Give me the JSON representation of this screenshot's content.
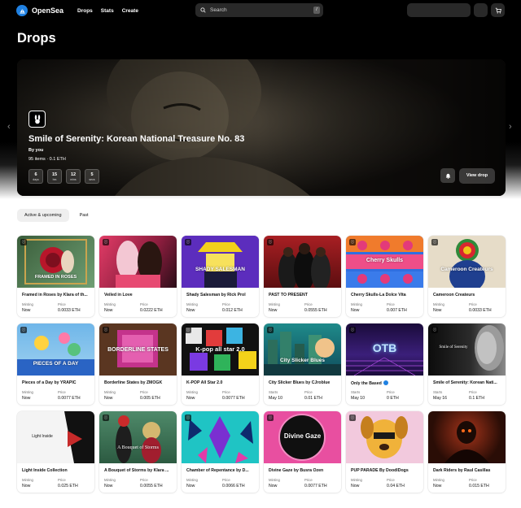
{
  "nav": {
    "brand": "OpenSea",
    "links": [
      "Drops",
      "Stats",
      "Create"
    ],
    "search_placeholder": "Search",
    "search_shortcut": "/"
  },
  "page": {
    "title": "Drops"
  },
  "hero": {
    "title": "Smile of Serenity: Korean National Treasure No. 83",
    "by": "By you",
    "meta": "95 items · 0.1 ETH",
    "countdown": [
      {
        "value": "6",
        "unit": "days"
      },
      {
        "value": "15",
        "unit": "hrs"
      },
      {
        "value": "12",
        "unit": "mins"
      },
      {
        "value": "5",
        "unit": "secs"
      }
    ],
    "view_label": "View drop"
  },
  "tabs": [
    "Active & upcoming",
    "Past"
  ],
  "cards": [
    {
      "title": "Framed in Roses by Klara of th...",
      "status_label": "Minting",
      "status_value": "Now",
      "price_label": "Price",
      "price_value": "0.0033 ETH",
      "thumb_text": "FRAMED IN ROSES"
    },
    {
      "title": "Veiled in Love",
      "status_label": "Minting",
      "status_value": "Now",
      "price_label": "Price",
      "price_value": "0.0222 ETH",
      "thumb_text": ""
    },
    {
      "title": "Shady Salesman by Rick Prol",
      "status_label": "Minting",
      "status_value": "Now",
      "price_label": "Price",
      "price_value": "0.012 ETH",
      "thumb_text": "SHADY SALESMAN"
    },
    {
      "title": "PAST TO PRESENT",
      "status_label": "Minting",
      "status_value": "Now",
      "price_label": "Price",
      "price_value": "0.0555 ETH",
      "thumb_text": ""
    },
    {
      "title": "Cherry Skulls-La Dolce Vita",
      "status_label": "Minting",
      "status_value": "Now",
      "price_label": "Price",
      "price_value": "0.007 ETH",
      "thumb_text": "Cherry Skulls"
    },
    {
      "title": "Cameroon Createurs",
      "status_label": "Minting",
      "status_value": "Now",
      "price_label": "Price",
      "price_value": "0.0033 ETH",
      "thumb_text": "Cameroon Createurs"
    },
    {
      "title": "Pieces of a Day by YRAPIC",
      "status_label": "Minting",
      "status_value": "Now",
      "price_label": "Price",
      "price_value": "0.0077 ETH",
      "thumb_text": "PIECES OF A DAY"
    },
    {
      "title": "Borderline States by ZMOGK",
      "status_label": "Minting",
      "status_value": "Now",
      "price_label": "Price",
      "price_value": "0.005 ETH",
      "thumb_text": "BORDERLINE STATES"
    },
    {
      "title": "K-POP All Star 2.0",
      "status_label": "Minting",
      "status_value": "Now",
      "price_label": "Price",
      "price_value": "0.0077 ETH",
      "thumb_text": "K-pop all star 2.0"
    },
    {
      "title": "City Slicker Blues by CJroblue",
      "status_label": "Starts",
      "status_value": "May 10",
      "price_label": "Price",
      "price_value": "0.01 ETH",
      "thumb_text": "City Slicker Blues"
    },
    {
      "title": "Only the Based",
      "status_label": "Starts",
      "status_value": "May 10",
      "price_label": "Price",
      "price_value": "0 ETH",
      "thumb_text": "OTB",
      "verified": true
    },
    {
      "title": "Smile of Serenity: Korean Nati...",
      "status_label": "Starts",
      "status_value": "May 16",
      "price_label": "Price",
      "price_value": "0.1 ETH",
      "thumb_text": "Smile of Serenity"
    },
    {
      "title": "Light Inside Collection",
      "status_label": "Minting",
      "status_value": "Now",
      "price_label": "Price",
      "price_value": "0.025 ETH",
      "thumb_text": "Light Inside"
    },
    {
      "title": "A Bouquet of Storms by Klara ...",
      "status_label": "Minting",
      "status_value": "Now",
      "price_label": "Price",
      "price_value": "0.0055 ETH",
      "thumb_text": "A Bouquet of Storms"
    },
    {
      "title": "Chamber of Repentance by D...",
      "status_label": "Minting",
      "status_value": "Now",
      "price_label": "Price",
      "price_value": "0.0066 ETH",
      "thumb_text": ""
    },
    {
      "title": "Divine Gaze by Busra Ozen",
      "status_label": "Minting",
      "status_value": "Now",
      "price_label": "Price",
      "price_value": "0.0077 ETH",
      "thumb_text": "Divine Gaze"
    },
    {
      "title": "PUP PARADE By DoodlDogs",
      "status_label": "Minting",
      "status_value": "Now",
      "price_label": "Price",
      "price_value": "0.04 ETH",
      "thumb_text": ""
    },
    {
      "title": "Dark Riders by Raul Casillas",
      "status_label": "Minting",
      "status_value": "Now",
      "price_label": "Price",
      "price_value": "0.015 ETH",
      "thumb_text": ""
    }
  ],
  "colors": {
    "brand_blue": "#2081e2",
    "header_bg": "#000000",
    "tab_active_bg": "#efefef"
  }
}
